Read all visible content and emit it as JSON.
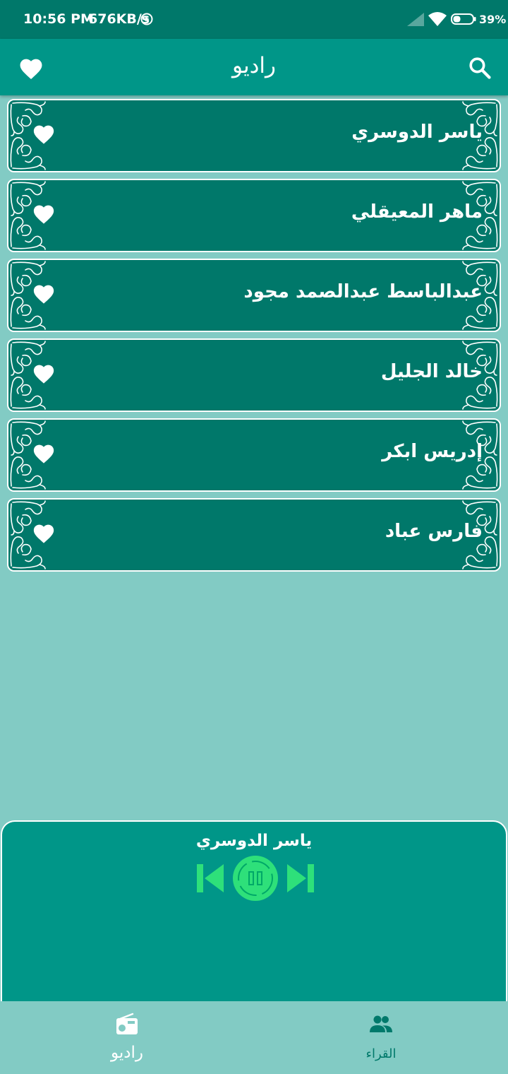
{
  "status_bar": {
    "time": "10:56 PM",
    "speed": "676KB/s",
    "battery": "39%"
  },
  "app_bar": {
    "title": "راديو"
  },
  "reciters": [
    {
      "name": "ياسر الدوسري"
    },
    {
      "name": "ماهر المعيقلي"
    },
    {
      "name": "عبدالباسط عبدالصمد مجود"
    },
    {
      "name": "خالد الجليل"
    },
    {
      "name": "إدريس ابكر"
    },
    {
      "name": "فارس عباد"
    }
  ],
  "player": {
    "now_playing": "ياسر الدوسري"
  },
  "bottom_nav": {
    "radio_label": "راديو",
    "readers_label": "القراء"
  },
  "colors": {
    "status_bar": "#00786a",
    "app_bar": "#009688",
    "card": "#00786a",
    "background": "#82cbc4",
    "player_accent": "#2ee07a"
  },
  "icons": {
    "favorite": "heart-icon",
    "search": "search-icon",
    "previous": "skip-previous-icon",
    "pause": "pause-icon",
    "next": "skip-next-icon",
    "radio": "radio-icon",
    "readers": "people-icon"
  }
}
